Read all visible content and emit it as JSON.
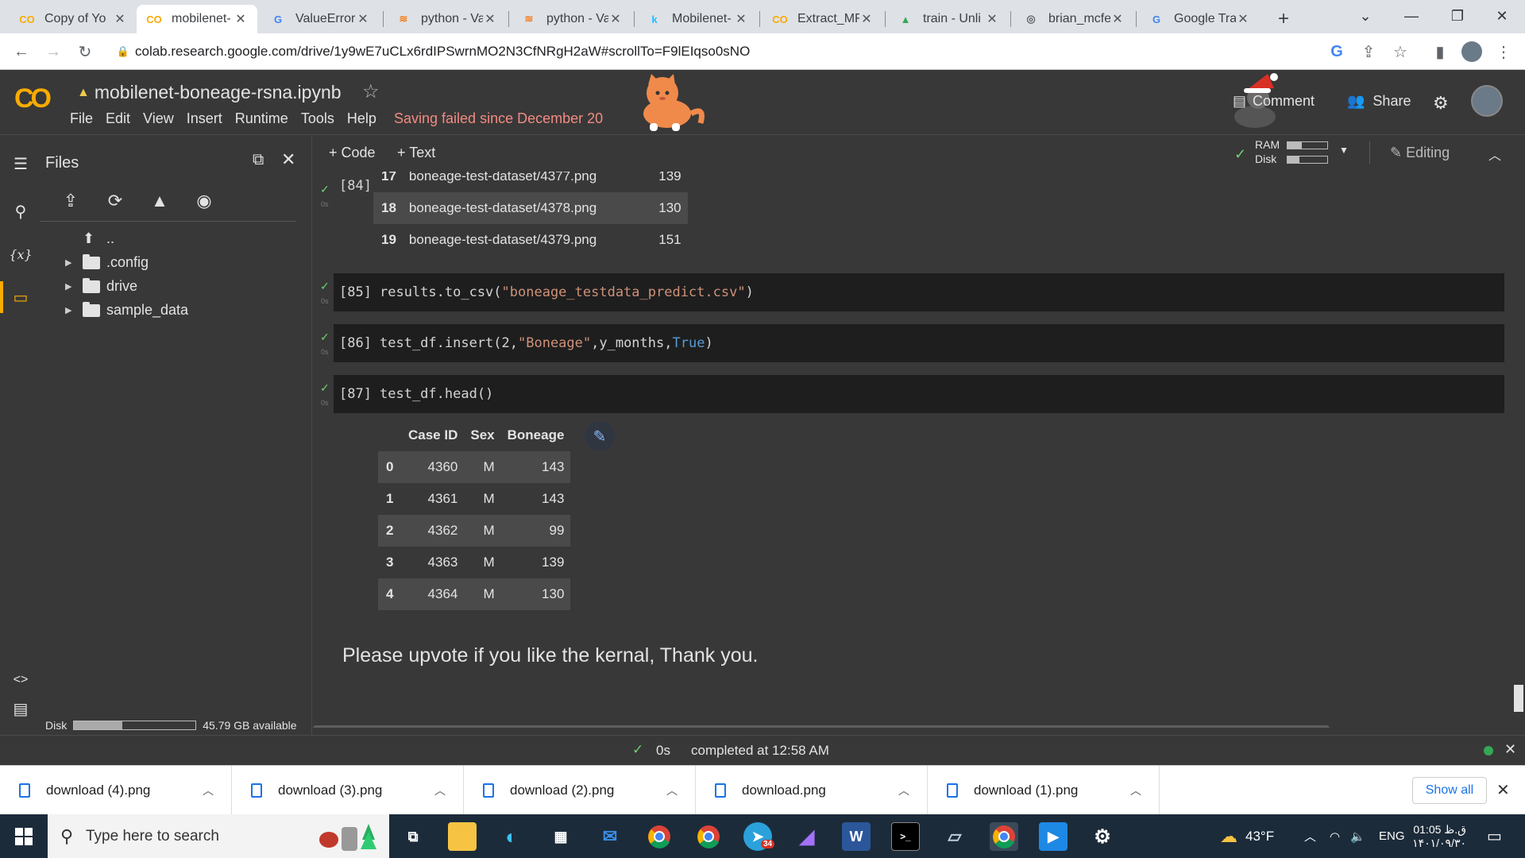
{
  "browser": {
    "tabs": [
      {
        "title": "Copy of Yo",
        "icon": "colab-icon",
        "color": "#f9ab00"
      },
      {
        "title": "mobilenet-",
        "icon": "colab-icon",
        "color": "#f9ab00"
      },
      {
        "title": "ValueError:",
        "icon": "google-icon",
        "color": "#4285f4"
      },
      {
        "title": "python - Va",
        "icon": "stackoverflow-icon",
        "color": "#f48024"
      },
      {
        "title": "python - Va",
        "icon": "stackoverflow-icon",
        "color": "#f48024"
      },
      {
        "title": "Mobilenet-",
        "icon": "kaggle-icon",
        "color": "#20beff"
      },
      {
        "title": "Extract_MF",
        "icon": "colab-icon",
        "color": "#f9ab00"
      },
      {
        "title": "train - Unli",
        "icon": "drive-icon",
        "color": "#34a853"
      },
      {
        "title": "brian_mcfe",
        "icon": "globe-icon",
        "color": "#5f6368"
      },
      {
        "title": "Google Tra",
        "icon": "translate-icon",
        "color": "#4285f4"
      }
    ],
    "url": "colab.research.google.com/drive/1y9wE7uCLx6rdIPSwrnMO2N3CfNRgH2aW#scrollTo=F9lEIqso0sNO"
  },
  "colab": {
    "notebook_title": "mobilenet-boneage-rsna.ipynb",
    "menu": [
      "File",
      "Edit",
      "View",
      "Insert",
      "Runtime",
      "Tools",
      "Help"
    ],
    "save_status": "Saving failed since December 20",
    "comment_label": "Comment",
    "share_label": "Share",
    "add_code": "+ Code",
    "add_text": "+ Text",
    "ram_label": "RAM",
    "disk_label": "Disk",
    "ram_fill": 0.35,
    "disk_fill": 0.3,
    "editing_label": "Editing"
  },
  "sidebar": {
    "title": "Files",
    "tree": [
      {
        "name": "..",
        "type": "up"
      },
      {
        "name": ".config",
        "type": "folder"
      },
      {
        "name": "drive",
        "type": "folder"
      },
      {
        "name": "sample_data",
        "type": "folder"
      }
    ],
    "disk_label": "Disk",
    "disk_available": "45.79 GB available",
    "disk_fill": 0.4
  },
  "cells": {
    "c84": {
      "num": "[84]",
      "secs": "0s",
      "rows": [
        {
          "idx": "17",
          "path": "boneage-test-dataset/4377.png",
          "val": "139"
        },
        {
          "idx": "18",
          "path": "boneage-test-dataset/4378.png",
          "val": "130"
        },
        {
          "idx": "19",
          "path": "boneage-test-dataset/4379.png",
          "val": "151"
        }
      ]
    },
    "c85": {
      "num": "[85]",
      "secs": "0s",
      "code_fn": "results.to_csv(",
      "code_str": "\"boneage_testdata_predict.csv\"",
      "code_end": ")"
    },
    "c86": {
      "num": "[86]",
      "secs": "0s",
      "code_a": "test_df.insert(2, ",
      "code_str": "\"Boneage\"",
      "code_b": ",y_months, ",
      "code_kw": "True",
      "code_end": ")"
    },
    "c87": {
      "num": "[87]",
      "secs": "0s",
      "code": "test_df.head()",
      "columns": [
        "Case ID",
        "Sex",
        "Boneage"
      ],
      "rows": [
        {
          "idx": "0",
          "id": "4360",
          "sex": "M",
          "age": "143"
        },
        {
          "idx": "1",
          "id": "4361",
          "sex": "M",
          "age": "143"
        },
        {
          "idx": "2",
          "id": "4362",
          "sex": "M",
          "age": "99"
        },
        {
          "idx": "3",
          "id": "4363",
          "sex": "M",
          "age": "139"
        },
        {
          "idx": "4",
          "id": "4364",
          "sex": "M",
          "age": "130"
        }
      ]
    },
    "text_cell": "Please upvote if you like the kernal, Thank you."
  },
  "status": {
    "duration": "0s",
    "message": "completed at 12:58 AM"
  },
  "downloads": {
    "items": [
      "download (4).png",
      "download (3).png",
      "download (2).png",
      "download.png",
      "download (1).png"
    ],
    "show_all": "Show all"
  },
  "taskbar": {
    "search_placeholder": "Type here to search",
    "weather": "43°F",
    "lang": "ENG",
    "time": "01:05 ق.ظ",
    "date": "۱۴۰۱/۰۹/۳۰",
    "telegram_badge": "34"
  }
}
